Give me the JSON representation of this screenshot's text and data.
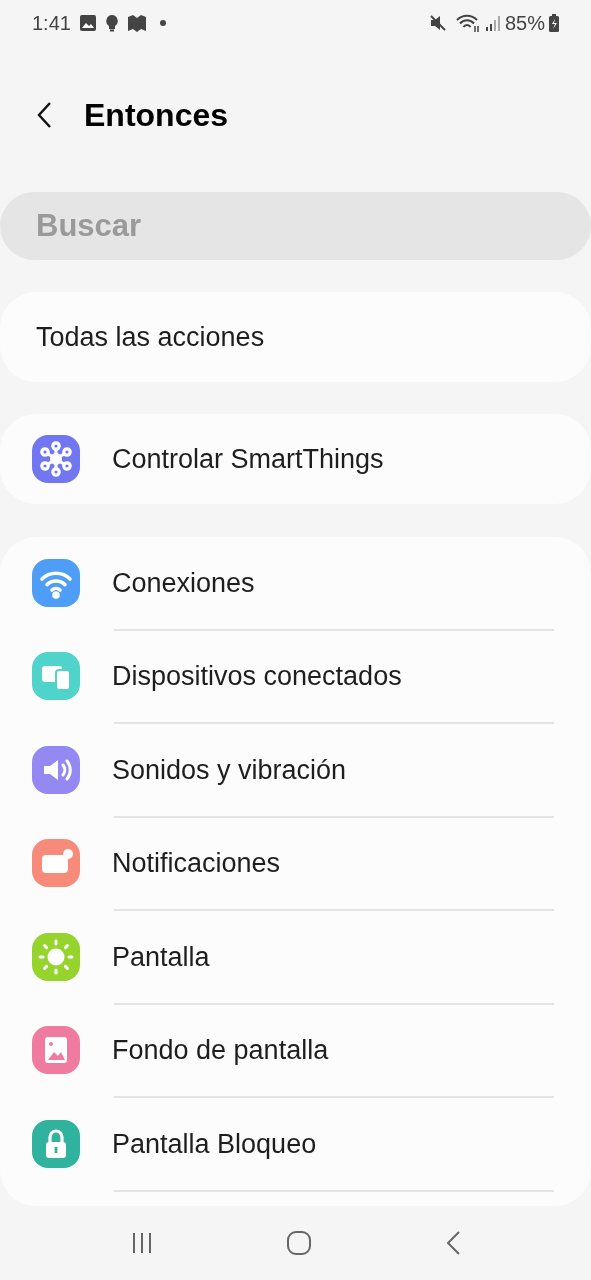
{
  "status_bar": {
    "time": "1:41",
    "battery": "85%"
  },
  "header": {
    "title": "Entonces"
  },
  "search": {
    "placeholder": "Buscar"
  },
  "all_actions": {
    "label": "Todas las acciones"
  },
  "smartthings": {
    "label": "Controlar SmartThings",
    "kind": "hub",
    "color": "#7177f0"
  },
  "items": [
    {
      "label": "Conexiones",
      "kind": "wifi",
      "color": "#4e9ef7"
    },
    {
      "label": "Dispositivos conectados",
      "kind": "devices",
      "color": "#4fd3cb"
    },
    {
      "label": "Sonidos y vibración",
      "kind": "sound",
      "color": "#9488f3"
    },
    {
      "label": "Notificaciones",
      "kind": "notification",
      "color": "#f78a78"
    },
    {
      "label": "Pantalla",
      "kind": "sun",
      "color": "#95d42d"
    },
    {
      "label": "Fondo de pantalla",
      "kind": "image",
      "color": "#f07ba0"
    },
    {
      "label": "Pantalla Bloqueo",
      "kind": "lock",
      "color": "#2fb39f"
    }
  ]
}
